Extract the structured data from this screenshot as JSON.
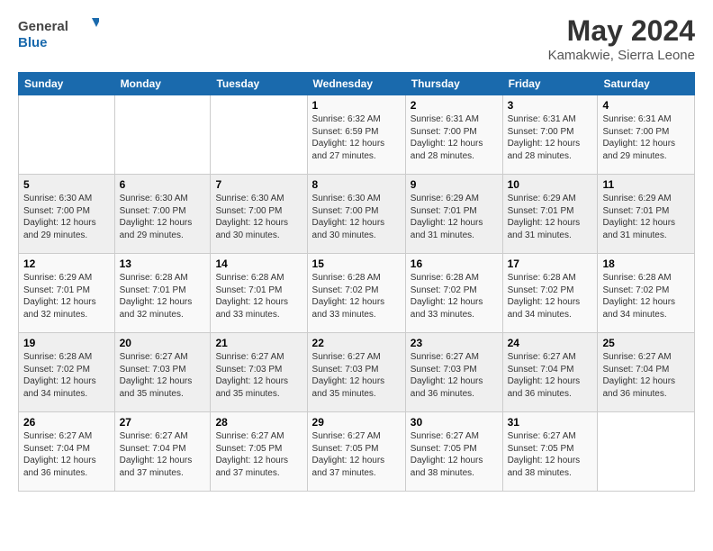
{
  "header": {
    "logo_general": "General",
    "logo_blue": "Blue",
    "month_year": "May 2024",
    "location": "Kamakwie, Sierra Leone"
  },
  "days_of_week": [
    "Sunday",
    "Monday",
    "Tuesday",
    "Wednesday",
    "Thursday",
    "Friday",
    "Saturday"
  ],
  "weeks": [
    [
      {
        "day": "",
        "info": ""
      },
      {
        "day": "",
        "info": ""
      },
      {
        "day": "",
        "info": ""
      },
      {
        "day": "1",
        "info": "Sunrise: 6:32 AM\nSunset: 6:59 PM\nDaylight: 12 hours and 27 minutes."
      },
      {
        "day": "2",
        "info": "Sunrise: 6:31 AM\nSunset: 7:00 PM\nDaylight: 12 hours and 28 minutes."
      },
      {
        "day": "3",
        "info": "Sunrise: 6:31 AM\nSunset: 7:00 PM\nDaylight: 12 hours and 28 minutes."
      },
      {
        "day": "4",
        "info": "Sunrise: 6:31 AM\nSunset: 7:00 PM\nDaylight: 12 hours and 29 minutes."
      }
    ],
    [
      {
        "day": "5",
        "info": "Sunrise: 6:30 AM\nSunset: 7:00 PM\nDaylight: 12 hours and 29 minutes."
      },
      {
        "day": "6",
        "info": "Sunrise: 6:30 AM\nSunset: 7:00 PM\nDaylight: 12 hours and 29 minutes."
      },
      {
        "day": "7",
        "info": "Sunrise: 6:30 AM\nSunset: 7:00 PM\nDaylight: 12 hours and 30 minutes."
      },
      {
        "day": "8",
        "info": "Sunrise: 6:30 AM\nSunset: 7:00 PM\nDaylight: 12 hours and 30 minutes."
      },
      {
        "day": "9",
        "info": "Sunrise: 6:29 AM\nSunset: 7:01 PM\nDaylight: 12 hours and 31 minutes."
      },
      {
        "day": "10",
        "info": "Sunrise: 6:29 AM\nSunset: 7:01 PM\nDaylight: 12 hours and 31 minutes."
      },
      {
        "day": "11",
        "info": "Sunrise: 6:29 AM\nSunset: 7:01 PM\nDaylight: 12 hours and 31 minutes."
      }
    ],
    [
      {
        "day": "12",
        "info": "Sunrise: 6:29 AM\nSunset: 7:01 PM\nDaylight: 12 hours and 32 minutes."
      },
      {
        "day": "13",
        "info": "Sunrise: 6:28 AM\nSunset: 7:01 PM\nDaylight: 12 hours and 32 minutes."
      },
      {
        "day": "14",
        "info": "Sunrise: 6:28 AM\nSunset: 7:01 PM\nDaylight: 12 hours and 33 minutes."
      },
      {
        "day": "15",
        "info": "Sunrise: 6:28 AM\nSunset: 7:02 PM\nDaylight: 12 hours and 33 minutes."
      },
      {
        "day": "16",
        "info": "Sunrise: 6:28 AM\nSunset: 7:02 PM\nDaylight: 12 hours and 33 minutes."
      },
      {
        "day": "17",
        "info": "Sunrise: 6:28 AM\nSunset: 7:02 PM\nDaylight: 12 hours and 34 minutes."
      },
      {
        "day": "18",
        "info": "Sunrise: 6:28 AM\nSunset: 7:02 PM\nDaylight: 12 hours and 34 minutes."
      }
    ],
    [
      {
        "day": "19",
        "info": "Sunrise: 6:28 AM\nSunset: 7:02 PM\nDaylight: 12 hours and 34 minutes."
      },
      {
        "day": "20",
        "info": "Sunrise: 6:27 AM\nSunset: 7:03 PM\nDaylight: 12 hours and 35 minutes."
      },
      {
        "day": "21",
        "info": "Sunrise: 6:27 AM\nSunset: 7:03 PM\nDaylight: 12 hours and 35 minutes."
      },
      {
        "day": "22",
        "info": "Sunrise: 6:27 AM\nSunset: 7:03 PM\nDaylight: 12 hours and 35 minutes."
      },
      {
        "day": "23",
        "info": "Sunrise: 6:27 AM\nSunset: 7:03 PM\nDaylight: 12 hours and 36 minutes."
      },
      {
        "day": "24",
        "info": "Sunrise: 6:27 AM\nSunset: 7:04 PM\nDaylight: 12 hours and 36 minutes."
      },
      {
        "day": "25",
        "info": "Sunrise: 6:27 AM\nSunset: 7:04 PM\nDaylight: 12 hours and 36 minutes."
      }
    ],
    [
      {
        "day": "26",
        "info": "Sunrise: 6:27 AM\nSunset: 7:04 PM\nDaylight: 12 hours and 36 minutes."
      },
      {
        "day": "27",
        "info": "Sunrise: 6:27 AM\nSunset: 7:04 PM\nDaylight: 12 hours and 37 minutes."
      },
      {
        "day": "28",
        "info": "Sunrise: 6:27 AM\nSunset: 7:05 PM\nDaylight: 12 hours and 37 minutes."
      },
      {
        "day": "29",
        "info": "Sunrise: 6:27 AM\nSunset: 7:05 PM\nDaylight: 12 hours and 37 minutes."
      },
      {
        "day": "30",
        "info": "Sunrise: 6:27 AM\nSunset: 7:05 PM\nDaylight: 12 hours and 38 minutes."
      },
      {
        "day": "31",
        "info": "Sunrise: 6:27 AM\nSunset: 7:05 PM\nDaylight: 12 hours and 38 minutes."
      },
      {
        "day": "",
        "info": ""
      }
    ]
  ]
}
